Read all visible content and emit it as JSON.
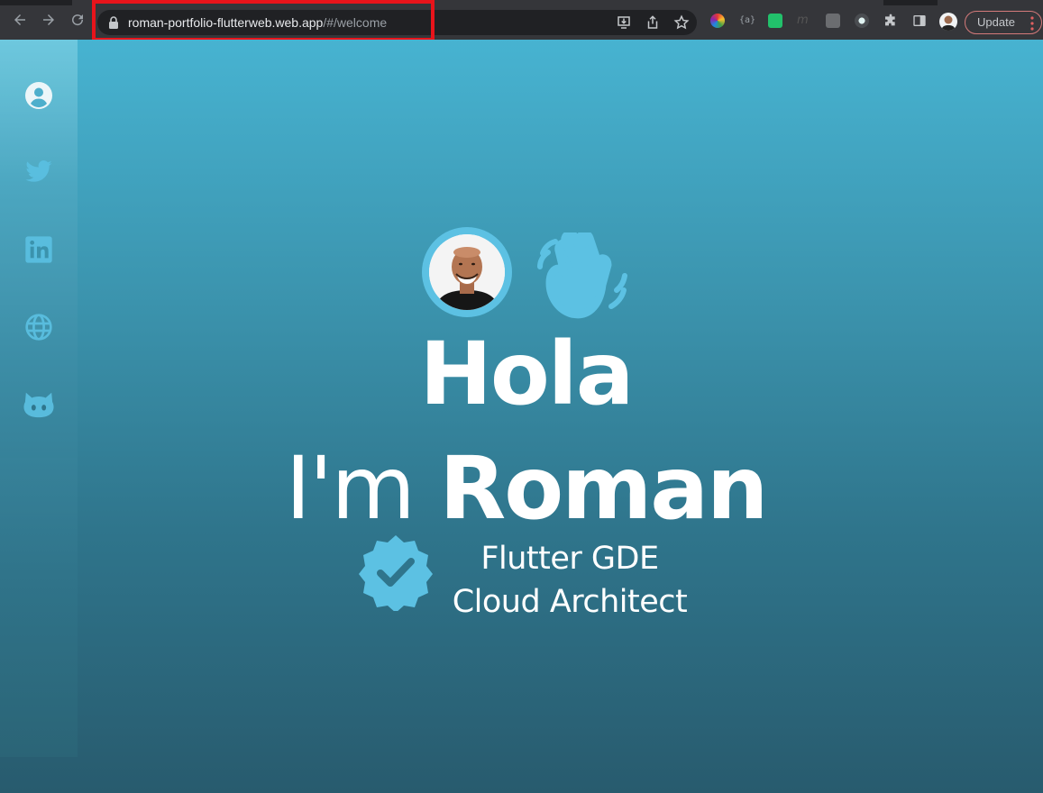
{
  "browser": {
    "url_host": "roman-portfolio-flutterweb.web.app",
    "url_path": "/#/welcome",
    "update_label": "Update",
    "icons": {
      "back": "back-arrow-icon",
      "forward": "forward-arrow-icon",
      "reload": "reload-icon",
      "lock": "lock-icon",
      "install": "install-app-icon",
      "share": "share-icon",
      "bookmark": "star-icon",
      "extensions": "puzzle-icon",
      "side_panel": "side-panel-icon",
      "menu": "kebab-menu-icon"
    },
    "colors": {
      "chrome": "#35363a",
      "omnibox": "#202124",
      "highlight": "#e8141b"
    }
  },
  "sidebar": {
    "items": [
      {
        "name": "profile",
        "icon": "account-circle-icon"
      },
      {
        "name": "twitter",
        "icon": "twitter-icon"
      },
      {
        "name": "linkedin",
        "icon": "linkedin-icon"
      },
      {
        "name": "website",
        "icon": "globe-icon"
      },
      {
        "name": "github",
        "icon": "github-icon"
      }
    ]
  },
  "hero": {
    "greeting": "Hola",
    "intro_prefix": "I'm",
    "name": "Roman",
    "roles": [
      "Flutter GDE",
      "Cloud Architect"
    ],
    "icons": {
      "avatar": "avatar",
      "wave": "waving-hand-icon",
      "badge": "verified-badge-icon"
    },
    "colors": {
      "accent": "#5cc1e3",
      "text": "#ffffff"
    }
  }
}
